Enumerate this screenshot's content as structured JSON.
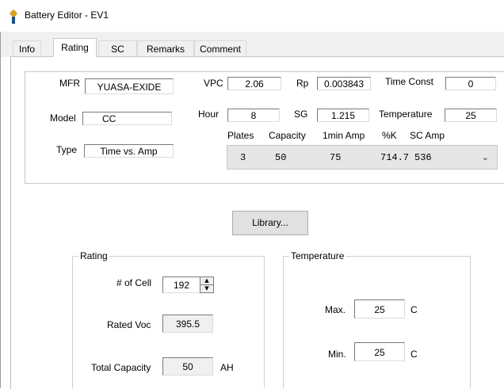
{
  "window": {
    "title": "Battery Editor - EV1",
    "icon": "battery-app-icon"
  },
  "tabs": [
    {
      "label": "Info",
      "active": false
    },
    {
      "label": "Rating",
      "active": true
    },
    {
      "label": "SC",
      "active": false
    },
    {
      "label": "Remarks",
      "active": false
    },
    {
      "label": "Comment",
      "active": false
    }
  ],
  "rating_tab": {
    "mfr": {
      "label": "MFR",
      "value": "YUASA-EXIDE"
    },
    "model": {
      "label": "Model",
      "value": "CC"
    },
    "type": {
      "label": "Type",
      "value": "Time vs. Amp"
    },
    "vpc": {
      "label": "VPC",
      "value": "2.06"
    },
    "hour": {
      "label": "Hour",
      "value": "8"
    },
    "rp": {
      "label": "Rp",
      "value": "0.003843"
    },
    "sg": {
      "label": "SG",
      "value": "1.215"
    },
    "time_const": {
      "label": "Time Const",
      "value": "0"
    },
    "temperature": {
      "label": "Temperature",
      "value": "25"
    },
    "capacity_table": {
      "headers": [
        "Plates",
        "Capacity",
        "1min Amp",
        "%K",
        "SC Amp"
      ],
      "selected": {
        "plates": "3",
        "capacity": "50",
        "one_min_amp": "75",
        "pct_k": "714.7",
        "sc_amp": "536"
      }
    },
    "library_button": "Library...",
    "rating_group": {
      "title": "Rating",
      "num_cells": {
        "label": "# of Cell",
        "value": "192"
      },
      "rated_voc": {
        "label": "Rated Voc",
        "value": "395.5"
      },
      "total_capacity": {
        "label": "Total Capacity",
        "value": "50",
        "unit": "AH"
      }
    },
    "temperature_group": {
      "title": "Temperature",
      "max": {
        "label": "Max.",
        "value": "25",
        "unit": "C"
      },
      "min": {
        "label": "Min.",
        "value": "25",
        "unit": "C"
      }
    }
  }
}
